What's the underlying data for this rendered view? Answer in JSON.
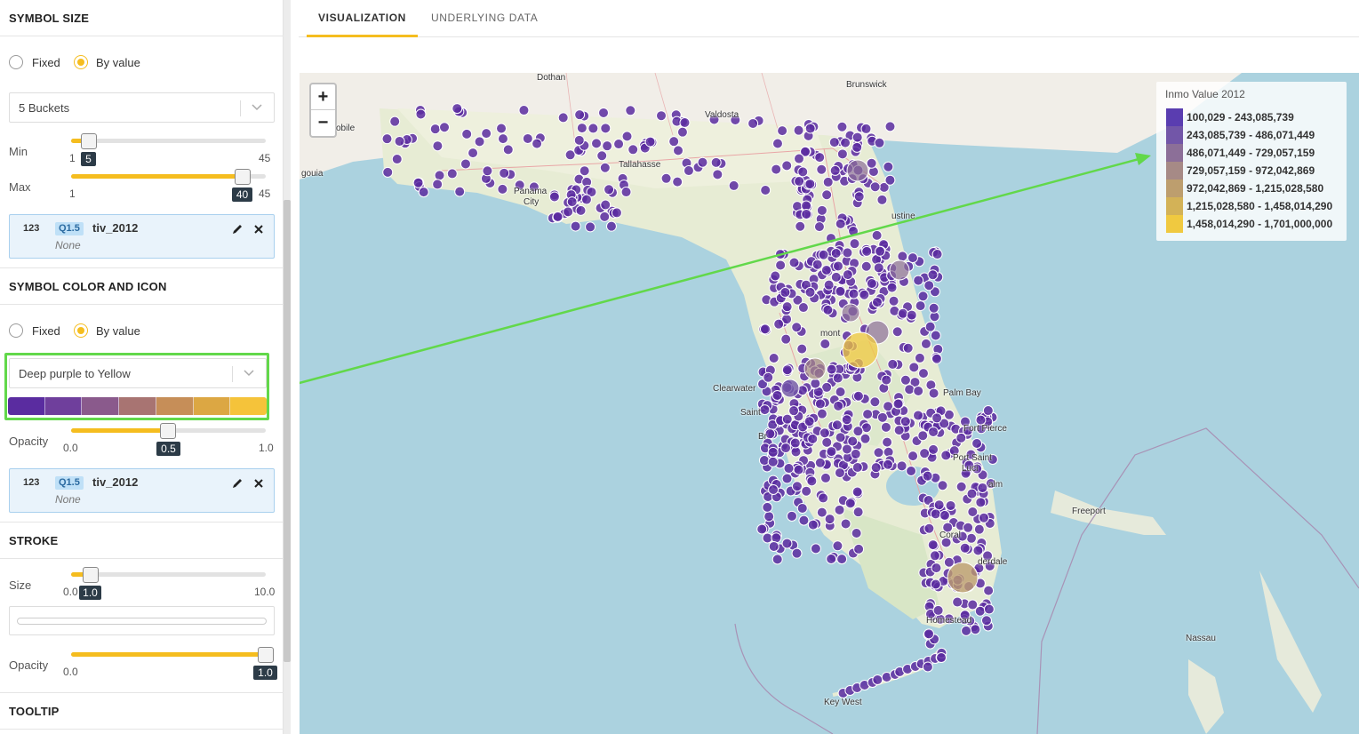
{
  "symbol_size": {
    "title": "SYMBOL SIZE",
    "mode_fixed": "Fixed",
    "mode_by_value": "By value",
    "selected_mode": "By value",
    "buckets": "5 Buckets",
    "min_label": "Min",
    "min_value": "5",
    "min_range_low": "1",
    "min_range_high": "45",
    "max_label": "Max",
    "max_value": "40",
    "max_range_low": "1",
    "max_range_high": "45",
    "field": {
      "type": "123",
      "quantifier": "Q1.5",
      "name": "tiv_2012",
      "aggregation": "None"
    }
  },
  "symbol_color": {
    "title": "SYMBOL COLOR AND ICON",
    "mode_fixed": "Fixed",
    "mode_by_value": "By value",
    "selected_mode": "By value",
    "palette_name": "Deep purple to Yellow",
    "palette_colors": [
      "#5a2ca0",
      "#6f3f9c",
      "#8a5a8c",
      "#a87472",
      "#c68e58",
      "#dca743",
      "#f5c33a"
    ],
    "opacity_label": "Opacity",
    "opacity_min": "0.0",
    "opacity_value": "0.5",
    "opacity_max": "1.0",
    "field": {
      "type": "123",
      "quantifier": "Q1.5",
      "name": "tiv_2012",
      "aggregation": "None"
    }
  },
  "stroke": {
    "title": "STROKE",
    "size_label": "Size",
    "size_min": "0.0",
    "size_value": "1.0",
    "size_max": "10.0",
    "opacity_label": "Opacity",
    "opacity_min": "0.0",
    "opacity_value": "1.0"
  },
  "tooltip": {
    "title": "TOOLTIP"
  },
  "tabs": {
    "visualization": "VISUALIZATION",
    "underlying_data": "UNDERLYING DATA",
    "active": "VISUALIZATION"
  },
  "map": {
    "zoom_in": "+",
    "zoom_out": "−",
    "legend": {
      "title": "Inmo Value 2012",
      "entries": [
        {
          "label": "100,029 - 243,085,739",
          "color": "#5a3db0"
        },
        {
          "label": "243,085,739 - 486,071,449",
          "color": "#7256a8"
        },
        {
          "label": "486,071,449 - 729,057,159",
          "color": "#8c6f98"
        },
        {
          "label": "729,057,159 - 972,042,869",
          "color": "#a68a86"
        },
        {
          "label": "972,042,869 - 1,215,028,580",
          "color": "#bd9e6e"
        },
        {
          "label": "1,215,028,580 - 1,458,014,290",
          "color": "#d3b257"
        },
        {
          "label": "1,458,014,290 - 1,701,000,000",
          "color": "#f0c940"
        }
      ]
    },
    "places": {
      "dothan": "Dothan",
      "brunswick": "Brunswick",
      "valdosta": "Valdosta",
      "mobile": "obile",
      "pensacola": "gouia",
      "panama": "Panama",
      "city": "City",
      "tallahassee": "Tallahasse",
      "augustine": "ustine",
      "clearwater": "Clearwater",
      "saint": "Saint",
      "orlando": "mont",
      "palm_bay": "Palm Bay",
      "fort_pierce": "Fort Pierce",
      "port_saint": "Port Saint",
      "lucie": "Luci",
      "palm": "alm",
      "coral": "Coral",
      "lauderdale": "derdale",
      "freeport": "Freeport",
      "nassau": "Nassau",
      "homestead": "Homestead",
      "key_west": "Key West",
      "bra": "Br"
    },
    "point_color": "#5a2ca0"
  }
}
